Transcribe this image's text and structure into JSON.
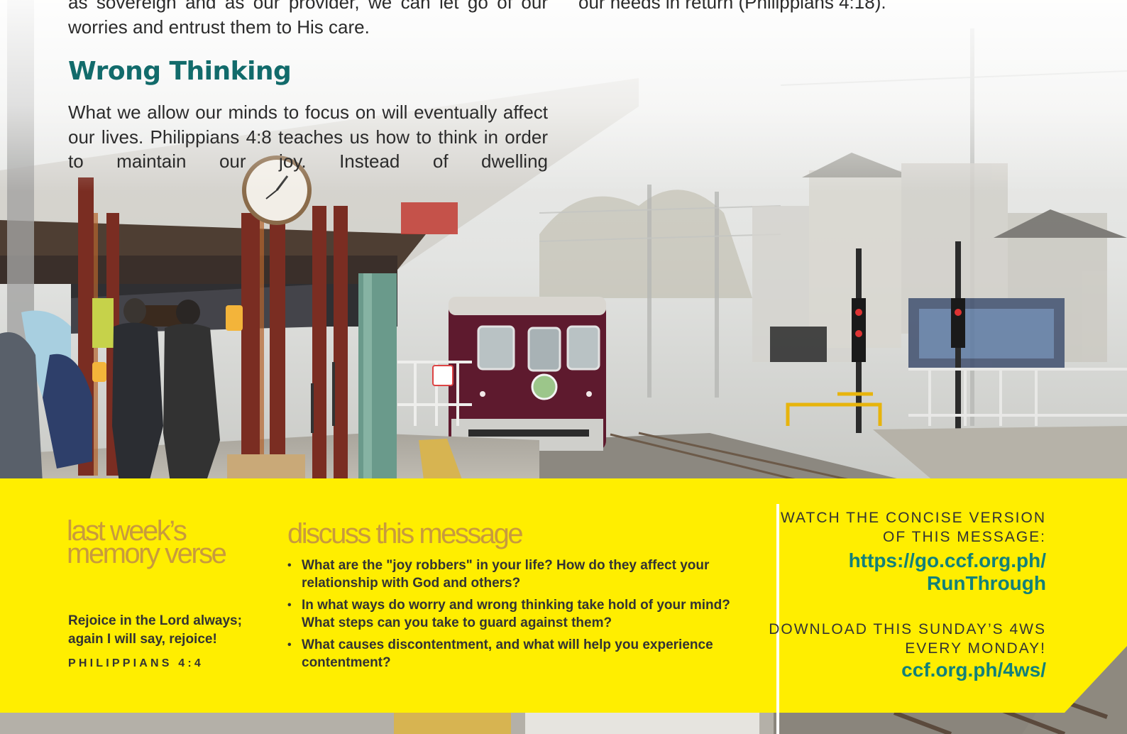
{
  "article": {
    "intro_left": "as sovereign and as our provider, we can let go of our worries and entrust them to His care.",
    "intro_right": "our needs in return (Philippians 4:18).",
    "section_heading": "Wrong Thinking",
    "section_body": "What we allow our minds to focus on will eventually affect our lives. Philippians 4:8 teaches us how to think in order to maintain our joy. Instead of dwelling"
  },
  "memory_verse": {
    "title": "last week’s memory verse",
    "verse": "Rejoice in the Lord always; again I will say, rejoice!",
    "reference": "PHILIPPIANS 4:4"
  },
  "discussion": {
    "title": "discuss this message",
    "questions": [
      "What are the \"joy robbers\" in your life? How do they affect your relationship with God and others?",
      "In what ways do worry and wrong thinking take hold of your mind? What steps can you take to guard against them?",
      "What causes discontentment, and what will help you experience contentment?"
    ]
  },
  "cta": {
    "watch_label": "WATCH THE CONCISE VERSION OF THIS MESSAGE:",
    "watch_link": "https://go.ccf.org.ph/ RunThrough",
    "download_label": "DOWNLOAD THIS SUNDAY’S 4WS EVERY MONDAY!",
    "download_link": "ccf.org.ph/4ws/"
  },
  "colors": {
    "heading_teal": "#126b6b",
    "link_teal": "#12807a",
    "band_yellow": "#ffee00",
    "title_gold": "#c89a3d",
    "train_maroon": "#5e1a2e"
  }
}
